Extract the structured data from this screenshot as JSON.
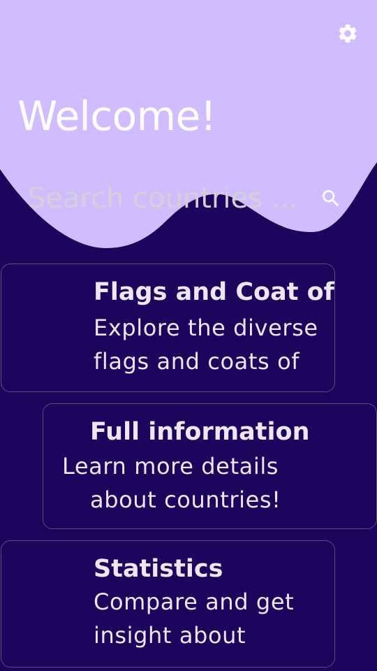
{
  "header": {
    "welcome_text": "Welcome!",
    "settings_icon": "gear-icon",
    "background_color": "#d0bcff"
  },
  "search": {
    "placeholder": "Search countries ...",
    "icon": "search-icon"
  },
  "cards": [
    {
      "title": "Flags and Coat of",
      "line1": "Explore the diverse",
      "line2": "flags and coats of"
    },
    {
      "title": "Full information",
      "line1": "Learn more details",
      "line2": "about countries!"
    },
    {
      "title": "Statistics",
      "line1": "Compare and get",
      "line2": "insight about"
    }
  ],
  "colors": {
    "background": "#1c035b",
    "accent": "#d0bcff",
    "card_border": "#5a4f7a",
    "text": "#ece6f5"
  }
}
